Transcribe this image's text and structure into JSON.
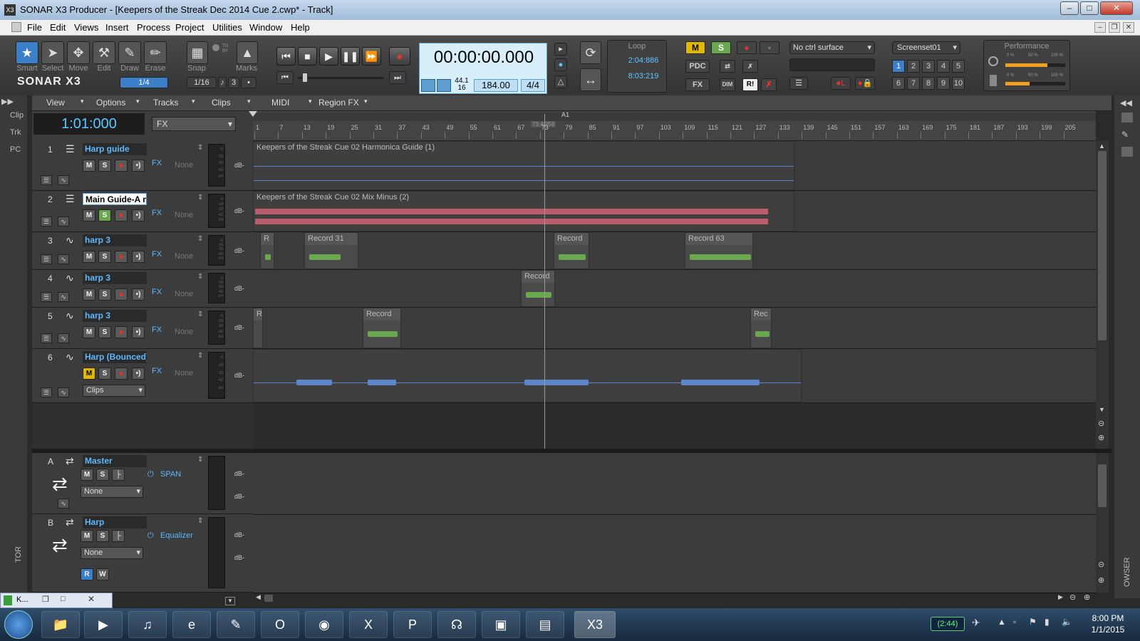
{
  "window": {
    "title": "SONAR X3 Producer - [Keepers of the Streak Dec 2014 Cue 2.cwp* - Track]",
    "icon_text": "X3"
  },
  "menu": [
    "File",
    "Edit",
    "Views",
    "Insert",
    "Process",
    "Project",
    "Utilities",
    "Window",
    "Help"
  ],
  "tools": [
    "Smart",
    "Select",
    "Move",
    "Edit",
    "Draw",
    "Erase"
  ],
  "brand": "SONAR X3",
  "snap": {
    "label": "Snap",
    "value": "1/16",
    "count": "3",
    "tb_label": "TO BY"
  },
  "marks_label": "Marks",
  "tool_value": "1/4",
  "transport": {
    "time": "00:00:00.000",
    "sample_rate": "44.1",
    "bit_depth": "16",
    "tempo": "184.00",
    "meter": "4/4"
  },
  "loop": {
    "label": "Loop",
    "start": "2:04:886",
    "end": "8:03:219"
  },
  "mix": {
    "m": "M",
    "s": "S",
    "pdc": "PDC",
    "fx": "FX",
    "dim": "DIM",
    "ri": "R!"
  },
  "ctrl_surface": "No ctrl surface",
  "screenset": {
    "name": "Screenset01",
    "numbers": [
      "1",
      "2",
      "3",
      "4",
      "5",
      "6",
      "7",
      "8",
      "9",
      "10"
    ]
  },
  "performance": {
    "label": "Performance",
    "p0": "0 %",
    "p50": "50 %",
    "p100": "100 %"
  },
  "left_strip": [
    "Clip",
    "Trk",
    "PC"
  ],
  "bottom_left_vert": "TOR",
  "bottom_right_vert": "OWSER",
  "trackview_menu": [
    "View",
    "Options",
    "Tracks",
    "Clips",
    "MIDI",
    "Region FX"
  ],
  "now_time": "1:01:000",
  "fx_select": "FX",
  "ruler": {
    "ticks": [
      "1",
      "7",
      "13",
      "19",
      "25",
      "31",
      "37",
      "43",
      "49",
      "55",
      "61",
      "67",
      "73",
      "79",
      "85",
      "91",
      "97",
      "103",
      "109",
      "115",
      "121",
      "127",
      "133",
      "139",
      "145",
      "151",
      "157",
      "163",
      "169",
      "175",
      "181",
      "187",
      "193",
      "199",
      "205"
    ],
    "marker": "A1",
    "cursor_pos": "73:4:258"
  },
  "db_label": "dB-",
  "meter_ticks": [
    "-6",
    "-18",
    "-30",
    "-42",
    "-54"
  ],
  "track_fx_label": "FX",
  "track_none": "None",
  "tracks": [
    {
      "num": "1",
      "name": "Harp guide"
    },
    {
      "num": "2",
      "name": "Main Guide-A ma"
    },
    {
      "num": "3",
      "name": "harp 3"
    },
    {
      "num": "4",
      "name": "harp 3"
    },
    {
      "num": "5",
      "name": "harp 3"
    },
    {
      "num": "6",
      "name": "Harp (Bounced)",
      "select": "Clips"
    }
  ],
  "clips": {
    "t1": "Keepers of the Streak Cue 02 Harmonica Guide (1)",
    "t2": "Keepers of the Streak Cue 02 Mix Minus (2)",
    "t3a": "R",
    "t3b": "Record 31",
    "t3c": "Record",
    "t3d": "Record 63",
    "t4a": "Record",
    "t5a": "R",
    "t5b": "Record",
    "t5c": "Rec"
  },
  "buses": [
    {
      "letter": "A",
      "name": "Master",
      "fx": "SPAN",
      "out": "None"
    },
    {
      "letter": "B",
      "name": "Harp",
      "fx": "Equalizer",
      "out": "None",
      "r": "R",
      "w": "W"
    }
  ],
  "minibar": "K...",
  "tray": {
    "time": "8:00 PM",
    "date": "1/1/2015",
    "battery": "(2:44)"
  },
  "taskbar_x3": "X3",
  "colors": {
    "accent": "#3a7fc8",
    "track_name": "#5cb8ff",
    "waveform_green": "#6aa84f",
    "waveform_red": "#d9667a",
    "waveform_blue": "#5b86c9"
  }
}
